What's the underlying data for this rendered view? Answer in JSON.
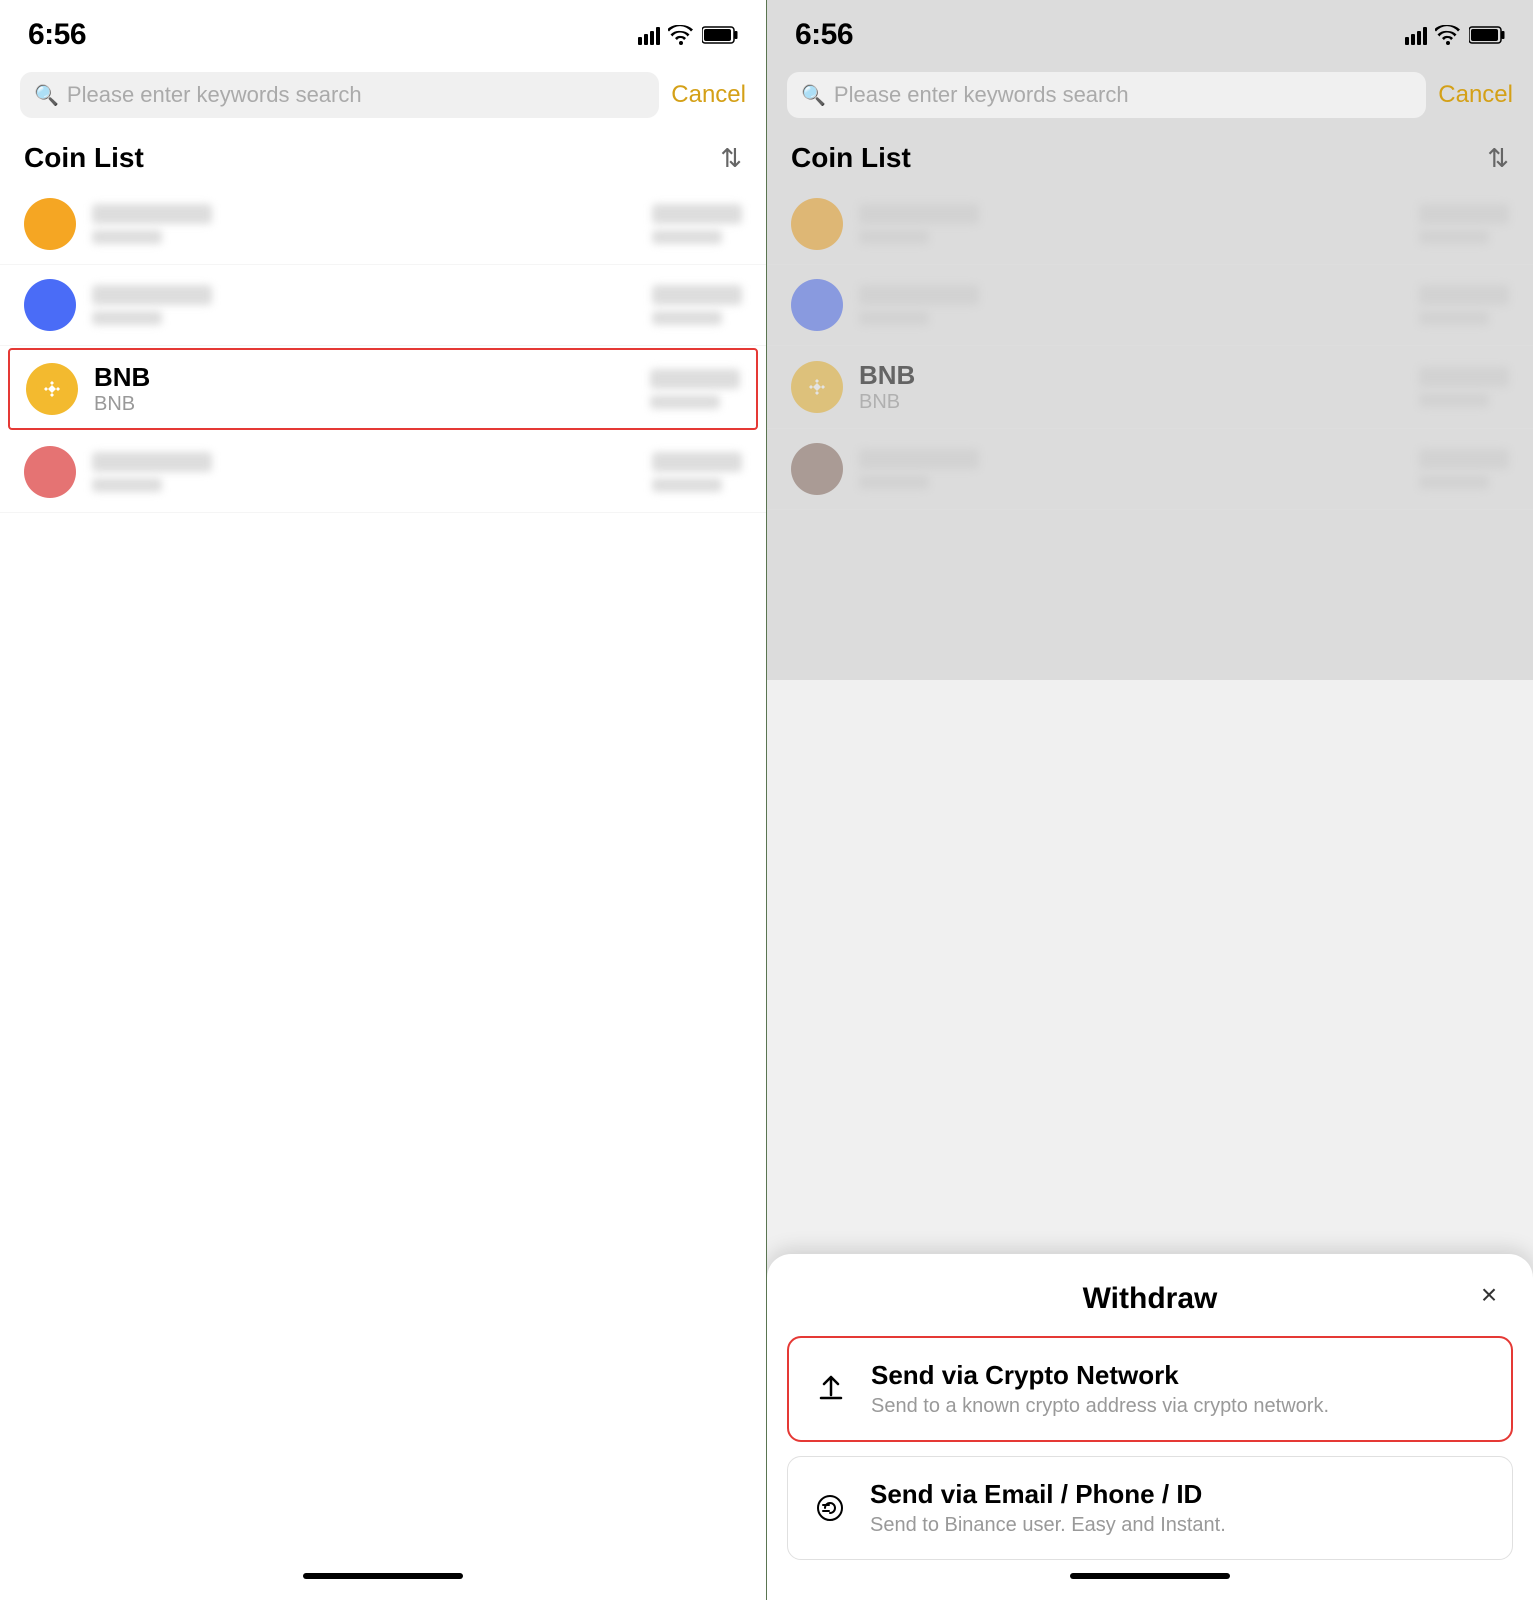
{
  "left_panel": {
    "status": {
      "time": "6:56"
    },
    "search": {
      "placeholder": "Please enter keywords search",
      "cancel_label": "Cancel"
    },
    "coin_list": {
      "title": "Coin List",
      "items": [
        {
          "id": "coin1",
          "color": "orange",
          "name": null,
          "symbol": null,
          "selected": false
        },
        {
          "id": "coin2",
          "color": "blue",
          "name": null,
          "symbol": null,
          "selected": false
        },
        {
          "id": "bnb",
          "color": "bnb",
          "name": "BNB",
          "symbol": "BNB",
          "selected": true
        },
        {
          "id": "coin4",
          "color": "pink",
          "name": null,
          "symbol": null,
          "selected": false
        }
      ]
    }
  },
  "right_panel": {
    "status": {
      "time": "6:56"
    },
    "search": {
      "placeholder": "Please enter keywords search",
      "cancel_label": "Cancel"
    },
    "coin_list": {
      "title": "Coin List",
      "items": [
        {
          "id": "coin1",
          "color": "orange",
          "name": null,
          "symbol": null,
          "selected": false
        },
        {
          "id": "coin2",
          "color": "blue",
          "name": null,
          "symbol": null,
          "selected": false
        },
        {
          "id": "bnb",
          "color": "bnb",
          "name": "BNB",
          "symbol": "BNB",
          "selected": false
        },
        {
          "id": "coin4",
          "color": "brown",
          "name": null,
          "symbol": null,
          "selected": false
        }
      ]
    },
    "bottom_sheet": {
      "title": "Withdraw",
      "close_label": "×",
      "options": [
        {
          "id": "crypto-network",
          "title": "Send via Crypto Network",
          "subtitle": "Send to a known crypto address via crypto network.",
          "highlighted": true
        },
        {
          "id": "email-phone",
          "title": "Send via Email / Phone / ID",
          "subtitle": "Send to Binance user. Easy and Instant.",
          "highlighted": false
        }
      ]
    }
  }
}
